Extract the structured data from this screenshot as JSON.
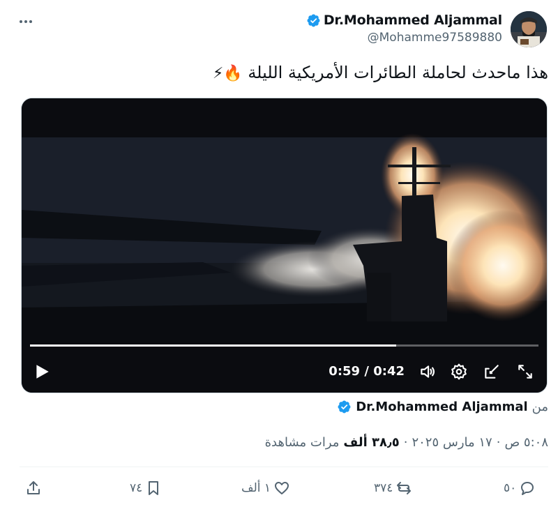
{
  "tweet": {
    "author_name": "Dr.Mohammed Aljammal",
    "handle": "@Mohamme97589880",
    "text": "هذا ماحدث لحاملة الطائرات الأمريكية الليلة",
    "emojis": "🔥⚡",
    "verified": true
  },
  "video": {
    "time_current": "0:59",
    "time_separator": "/",
    "time_total": "0:42",
    "progress": 0.72,
    "controls": [
      "play-icon",
      "volume-icon",
      "settings-icon",
      "pop-out-icon",
      "fullscreen-icon"
    ]
  },
  "source": {
    "from_label": "من",
    "name": "Dr.Mohammed Aljammal"
  },
  "meta": {
    "time": "٥:٠٨ ص",
    "sep1": "·",
    "date": "١٧ مارس ٢٠٢٥",
    "sep2": "·",
    "views_count": "٣٨٫٥ ألف",
    "views_label": "مرات مشاهدة"
  },
  "actions": {
    "replies": "٥٠",
    "reposts": "٣٧٤",
    "likes": "١ ألف",
    "bookmarks": "٧٤"
  },
  "colors": {
    "accent": "#1d9bf0",
    "muted": "#536471",
    "text": "#0f1419"
  }
}
